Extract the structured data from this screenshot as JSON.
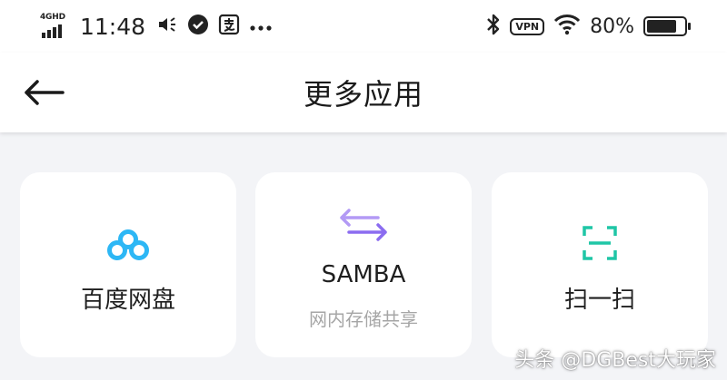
{
  "status_bar": {
    "network": "4GHD",
    "time": "11:48",
    "vpn": "VPN",
    "battery_percent": "80%",
    "battery_level": 0.8,
    "icons": [
      "signal-icon",
      "volume-icon",
      "check-circle-icon",
      "alipay-icon",
      "more-dots-icon",
      "bluetooth-icon",
      "vpn-icon",
      "wifi-icon",
      "battery-icon"
    ]
  },
  "header": {
    "title": "更多应用",
    "back_icon": "back-arrow-icon"
  },
  "apps": [
    {
      "label": "百度网盘",
      "icon": "baidu-netdisk-icon",
      "color": "#2db7f5"
    },
    {
      "label": "SAMBA",
      "sublabel": "网内存储共享",
      "icon": "swap-arrows-icon",
      "color": "#9b7cf2"
    },
    {
      "label": "扫一扫",
      "icon": "scan-icon",
      "color": "#1fc6a6"
    }
  ],
  "watermark": "头条 @DGBest大玩家"
}
